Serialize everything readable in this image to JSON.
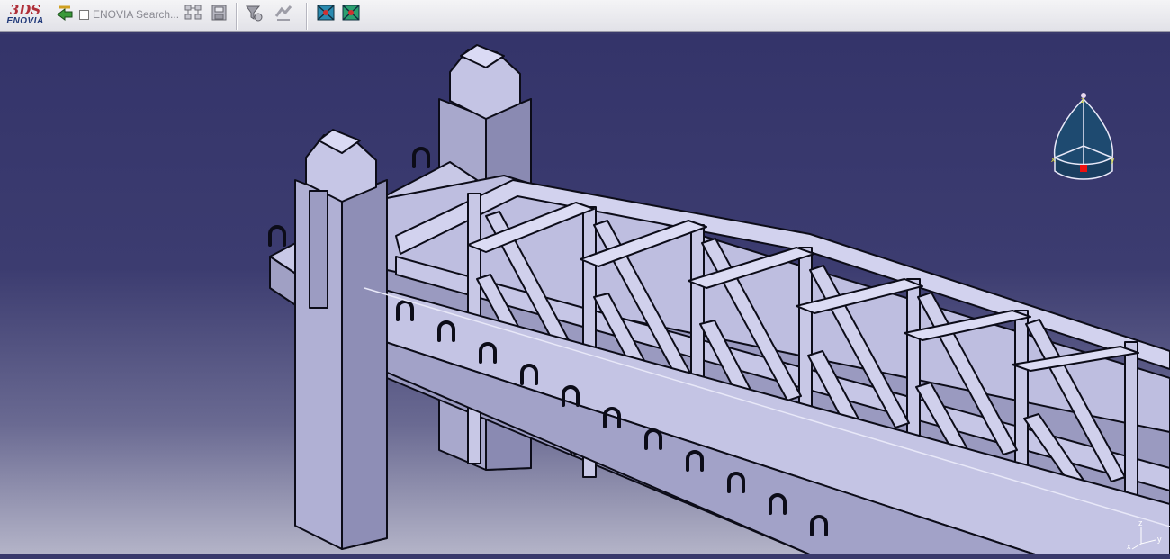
{
  "toolbar": {
    "logo_mark": "3DS",
    "logo_text": "ENOVIA",
    "search_label": "ENOVIA Search...",
    "icons": [
      "enovia-navigate-icon",
      "checkbox-icon",
      "tree-explode-icon",
      "save-icon",
      "filter-icon",
      "refresh-icon",
      "view-normal-icon",
      "view-highlight-icon"
    ]
  },
  "viewport": {
    "background_top": "#34346a",
    "background_bottom": "#b4b4c8",
    "model_color": "#c8c8e6",
    "edge_color": "#0c0c18"
  },
  "compass": {
    "axis_z": "z",
    "axis_x": "x",
    "axis_y": "y"
  },
  "mini_axis": {
    "axis_z": "z",
    "axis_x": "x",
    "axis_y": "y"
  }
}
